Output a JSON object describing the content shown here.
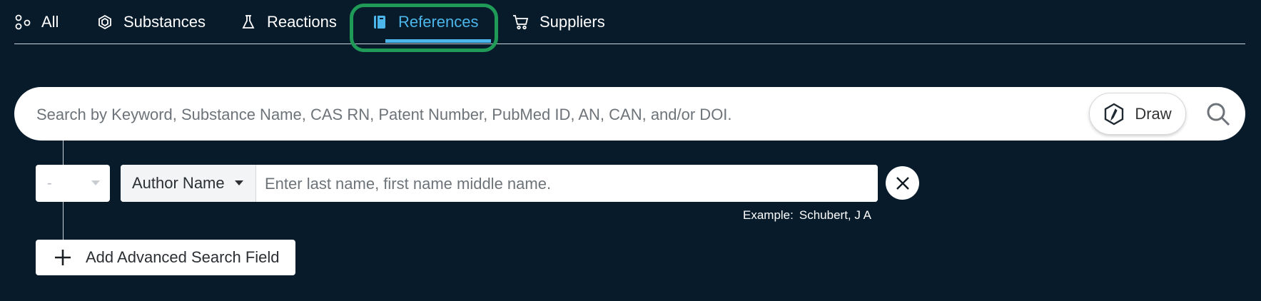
{
  "tabs": [
    {
      "label": "All",
      "icon": "nodes-icon"
    },
    {
      "label": "Substances",
      "icon": "hexagon-icon"
    },
    {
      "label": "Reactions",
      "icon": "flask-icon"
    },
    {
      "label": "References",
      "icon": "book-icon",
      "active": true
    },
    {
      "label": "Suppliers",
      "icon": "cart-icon"
    }
  ],
  "search": {
    "placeholder": "Search by Keyword, Substance Name, CAS RN, Patent Number, PubMed ID, AN, CAN, and/or DOI.",
    "value": "",
    "draw_label": "Draw"
  },
  "advanced": {
    "operator_value": "-",
    "field_label": "Author Name",
    "input_placeholder": "Enter last name, first name middle name.",
    "input_value": "",
    "example_label": "Example:",
    "example_value": "Schubert, J A",
    "add_label": "Add Advanced Search Field"
  },
  "colors": {
    "background": "#071b2b",
    "accent": "#4cb6ea",
    "highlight": "#1f9a57"
  }
}
